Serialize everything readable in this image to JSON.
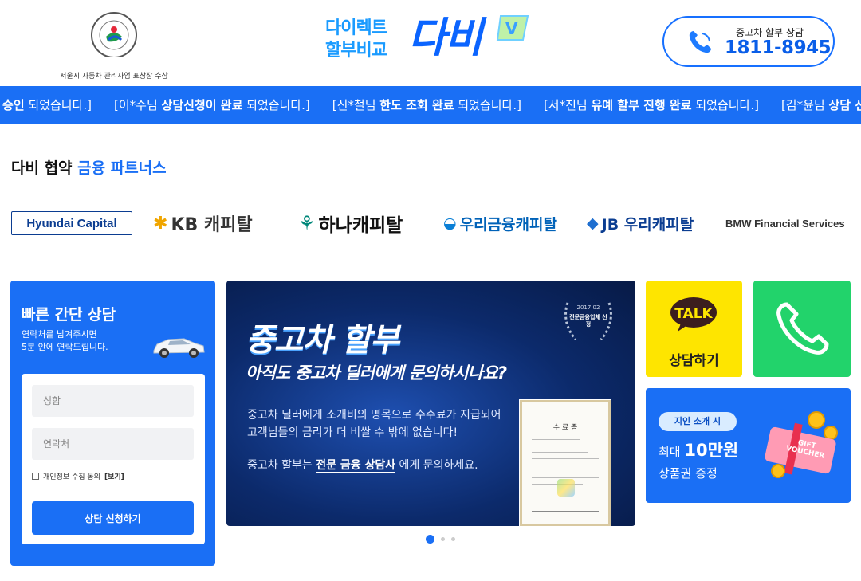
{
  "header": {
    "seal_caption": "서울시 자동차 관리사업 표창장 수상",
    "brand_sub_line1": "다이렉트",
    "brand_sub_line2": "할부비교",
    "brand_main": "다비",
    "phone_label": "중고차 할부 상담",
    "phone_number": "1811-8945"
  },
  "ticker": [
    {
      "pre": "",
      "bold": "향 승인",
      "post": " 되었습니다.]"
    },
    {
      "pre": "[이*수님 ",
      "bold": "상담신청이 완료",
      "post": " 되었습니다.]"
    },
    {
      "pre": "[신*철님 ",
      "bold": "한도 조회 완료",
      "post": " 되었습니다.]"
    },
    {
      "pre": "[서*진님 ",
      "bold": "유예 할부 진행 완료",
      "post": " 되었습니다.]"
    },
    {
      "pre": "[김*윤님 ",
      "bold": "상담 신",
      "post": ""
    }
  ],
  "partners": {
    "title_pre": "다비 협약 ",
    "title_hl": "금융 파트너스",
    "logos": [
      "Hyundai Capital",
      "KB 캐피탈",
      "하나캐피탈",
      "우리금융캐피탈",
      "JB 우리캐피탈",
      "BMW Financial Services"
    ]
  },
  "consult": {
    "title": "빠른 간단 상담",
    "desc_line1": "연락처를 남겨주시면",
    "desc_line2": "5분 안에 연락드립니다.",
    "name_placeholder": "성함",
    "phone_placeholder": "연락처",
    "agree_label": "개인정보 수집 동의",
    "agree_view": "[보기]",
    "submit_label": "상담 신청하기"
  },
  "banner": {
    "title": "중고차 할부",
    "subtitle": "아직도 중고차 딜러에게 문의하시나요?",
    "body_line1": "중고차 딜러에게 소개비의 명목으로 수수료가 지급되어",
    "body_line2": "고객님들의 금리가 더 비쌀 수 밖에 없습니다!",
    "body2_pre": "중고차 할부는 ",
    "body2_bold": "전문 금융 상담사",
    "body2_post": " 에게 문의하세요.",
    "award_year": "2017.02",
    "award_text": "전문금융업체 선정",
    "certificate_title": "수 료 증"
  },
  "carousel": {
    "total": 3,
    "active": 0
  },
  "kakao": {
    "bubble": "TALK",
    "label": "상담하기"
  },
  "gift": {
    "pill": "지인 소개 시",
    "line1_pre": "최대 ",
    "line1_bold": "10만원",
    "line2": "상품권 증정",
    "voucher_text": "GIFT VOUCHER"
  },
  "colors": {
    "primary": "#1a6ff5",
    "kakao": "#fee500",
    "call": "#22d36b"
  }
}
